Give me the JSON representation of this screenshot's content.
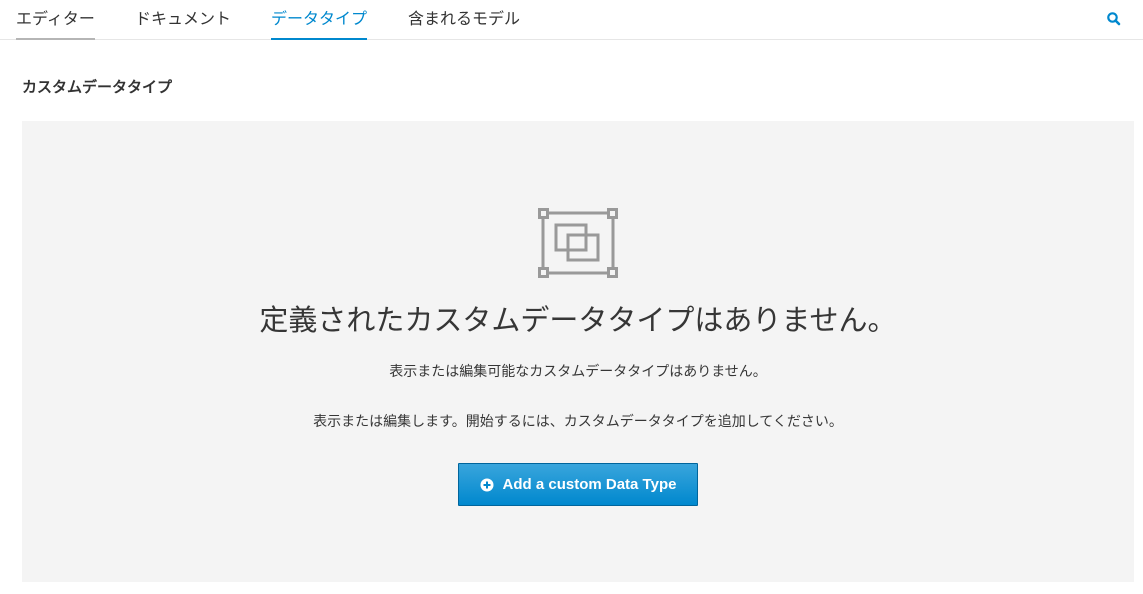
{
  "tabs": [
    {
      "label": "エディター",
      "active": false
    },
    {
      "label": "ドキュメント",
      "active": false
    },
    {
      "label": "データタイプ",
      "active": true
    },
    {
      "label": "含まれるモデル",
      "active": false
    }
  ],
  "toolbar": {
    "search_icon": "search-icon"
  },
  "section": {
    "title": "カスタムデータタイプ"
  },
  "empty_state": {
    "icon": "object-group-icon",
    "title": "定義されたカスタムデータタイプはありません。",
    "line1": "表示または編集可能なカスタムデータタイプはありません。",
    "line2": "表示または編集します。開始するには、カスタムデータタイプを追加してください。",
    "button_label": "Add a custom Data Type",
    "button_icon": "plus-circle-icon"
  },
  "colors": {
    "accent": "#0088ce",
    "panel_bg": "#f4f4f4",
    "icon_gray": "#999999"
  }
}
